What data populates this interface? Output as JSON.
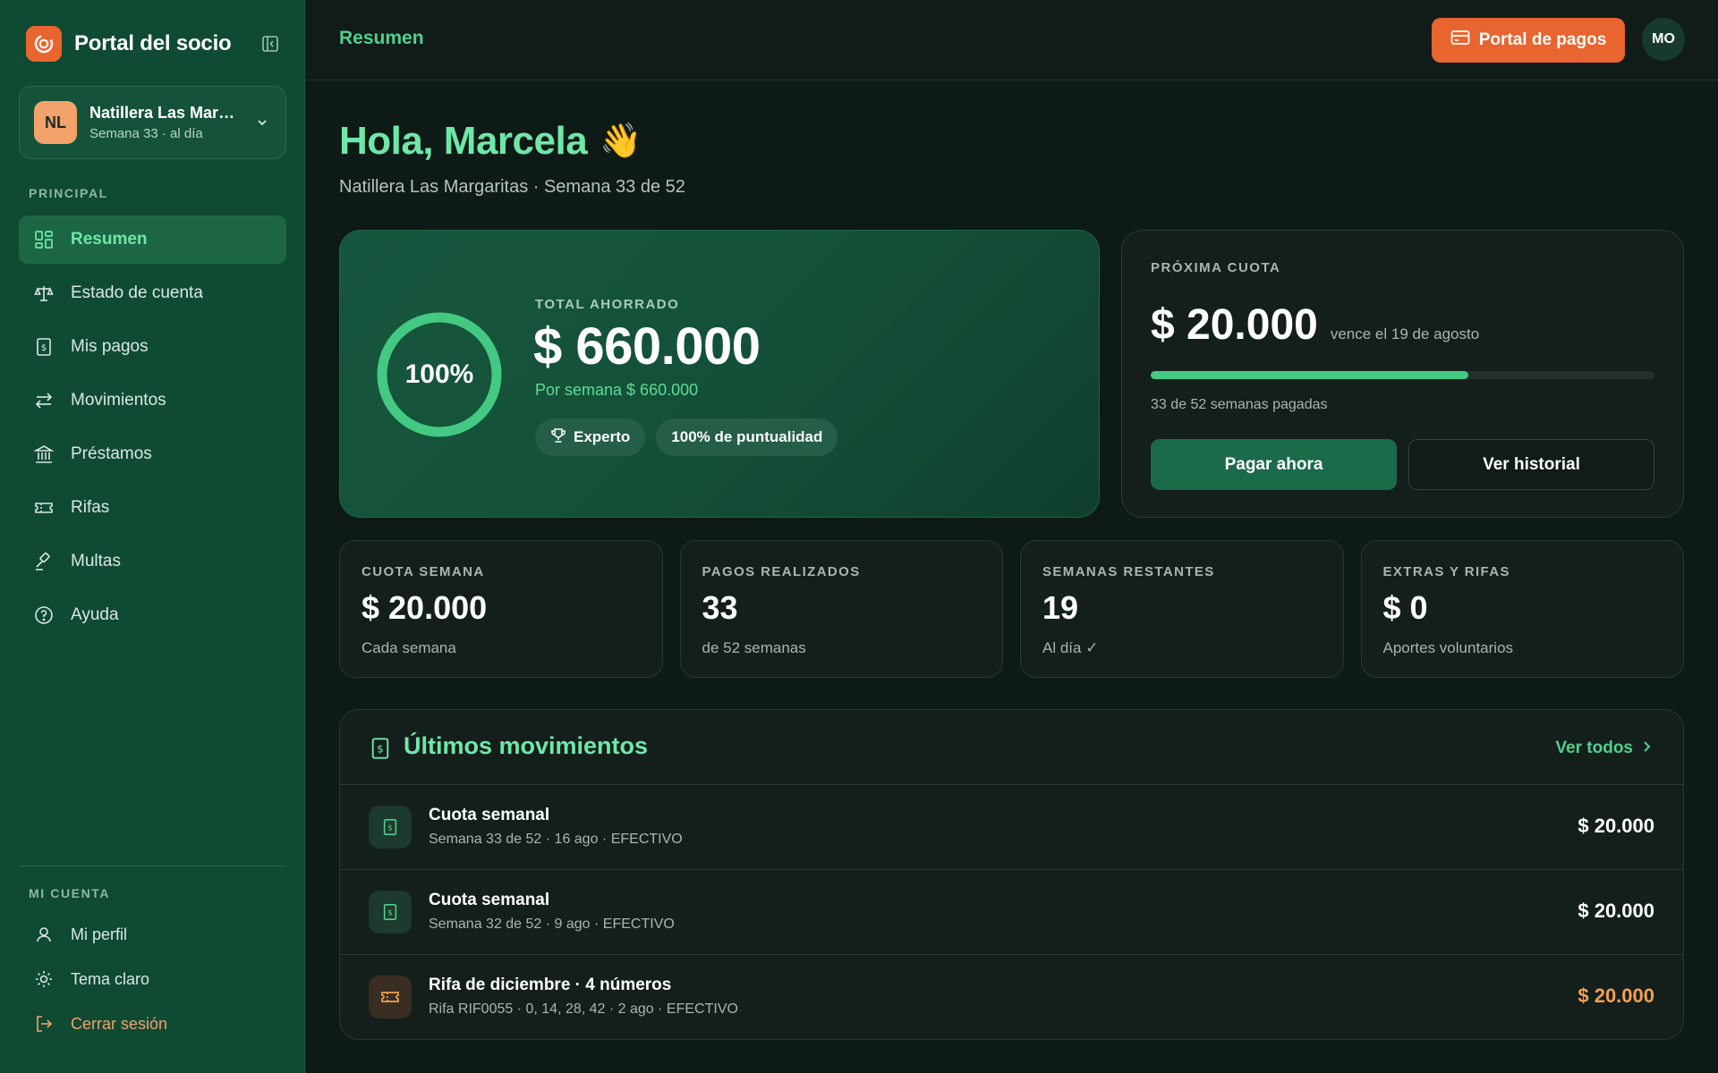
{
  "sidebar": {
    "brand": "Portal del socio",
    "group": {
      "initials": "NL",
      "name": "Natillera Las Margaritas",
      "status": "Semana 33 · al día"
    },
    "section_main": "PRINCIPAL",
    "items": [
      {
        "label": "Resumen",
        "icon": "dashboard-icon",
        "active": true
      },
      {
        "label": "Estado de cuenta",
        "icon": "scale-icon"
      },
      {
        "label": "Mis pagos",
        "icon": "receipt-icon"
      },
      {
        "label": "Movimientos",
        "icon": "transfer-icon"
      },
      {
        "label": "Préstamos",
        "icon": "bank-icon"
      },
      {
        "label": "Rifas",
        "icon": "ticket-icon"
      },
      {
        "label": "Multas",
        "icon": "gavel-icon"
      },
      {
        "label": "Ayuda",
        "icon": "help-icon"
      }
    ],
    "section_account": "MI CUENTA",
    "account_items": [
      {
        "label": "Mi perfil",
        "icon": "user-icon"
      },
      {
        "label": "Tema claro",
        "icon": "sun-icon"
      },
      {
        "label": "Cerrar sesión",
        "icon": "logout-icon"
      }
    ]
  },
  "topbar": {
    "title": "Resumen",
    "pay_portal": "Portal de pagos",
    "user_initials": "MO"
  },
  "main": {
    "greeting": "Hola, Marcela",
    "greeting_emoji": "👋",
    "subheading": "Natillera Las Margaritas · Semana 33 de 52"
  },
  "hero": {
    "ring_percent_label": "100%",
    "ring_fraction": 1.0,
    "label": "TOTAL AHORRADO",
    "amount": "$ 660.000",
    "per_week": "Por semana $ 660.000",
    "badges": [
      "Experto",
      "100% de puntualidad"
    ]
  },
  "next_payment": {
    "label": "PRÓXIMA CUOTA",
    "amount": "$ 20.000",
    "due": "vence el 19 de agosto",
    "progress_fraction": 0.63,
    "weeks_paid": "33 de 52 semanas pagadas",
    "pay_button": "Pagar ahora",
    "history_button": "Ver historial"
  },
  "stats": [
    {
      "label": "CUOTA SEMANA",
      "value": "$ 20.000",
      "sub": "Cada semana"
    },
    {
      "label": "PAGOS REALIZADOS",
      "value": "33",
      "sub": "de 52 semanas"
    },
    {
      "label": "SEMANAS RESTANTES",
      "value": "19",
      "sub": "Al día ✓"
    },
    {
      "label": "EXTRAS Y RIFAS",
      "value": "$ 0",
      "sub": "Aportes voluntarios"
    }
  ],
  "movements": {
    "title": "Últimos movimientos",
    "see_all": "Ver todos",
    "rows": [
      {
        "title": "Cuota semanal",
        "sub": "Semana 33 de 52 · 16 ago · EFECTIVO",
        "amount": "$ 20.000",
        "kind": "receipt"
      },
      {
        "title": "Cuota semanal",
        "sub": "Semana 32 de 52 · 9 ago · EFECTIVO",
        "amount": "$ 20.000",
        "kind": "receipt"
      },
      {
        "title": "Rifa de diciembre · 4 números",
        "sub": "Rifa RIF0055 · 0, 14, 28, 42 · 2 ago · EFECTIVO",
        "amount": "$ 20.000",
        "kind": "raffle"
      }
    ]
  },
  "colors": {
    "accent_green": "#6ee7a8",
    "brand_orange": "#e8652f",
    "raffle_orange": "#f3a04f",
    "sidebar_bg": "#0f4a33"
  }
}
